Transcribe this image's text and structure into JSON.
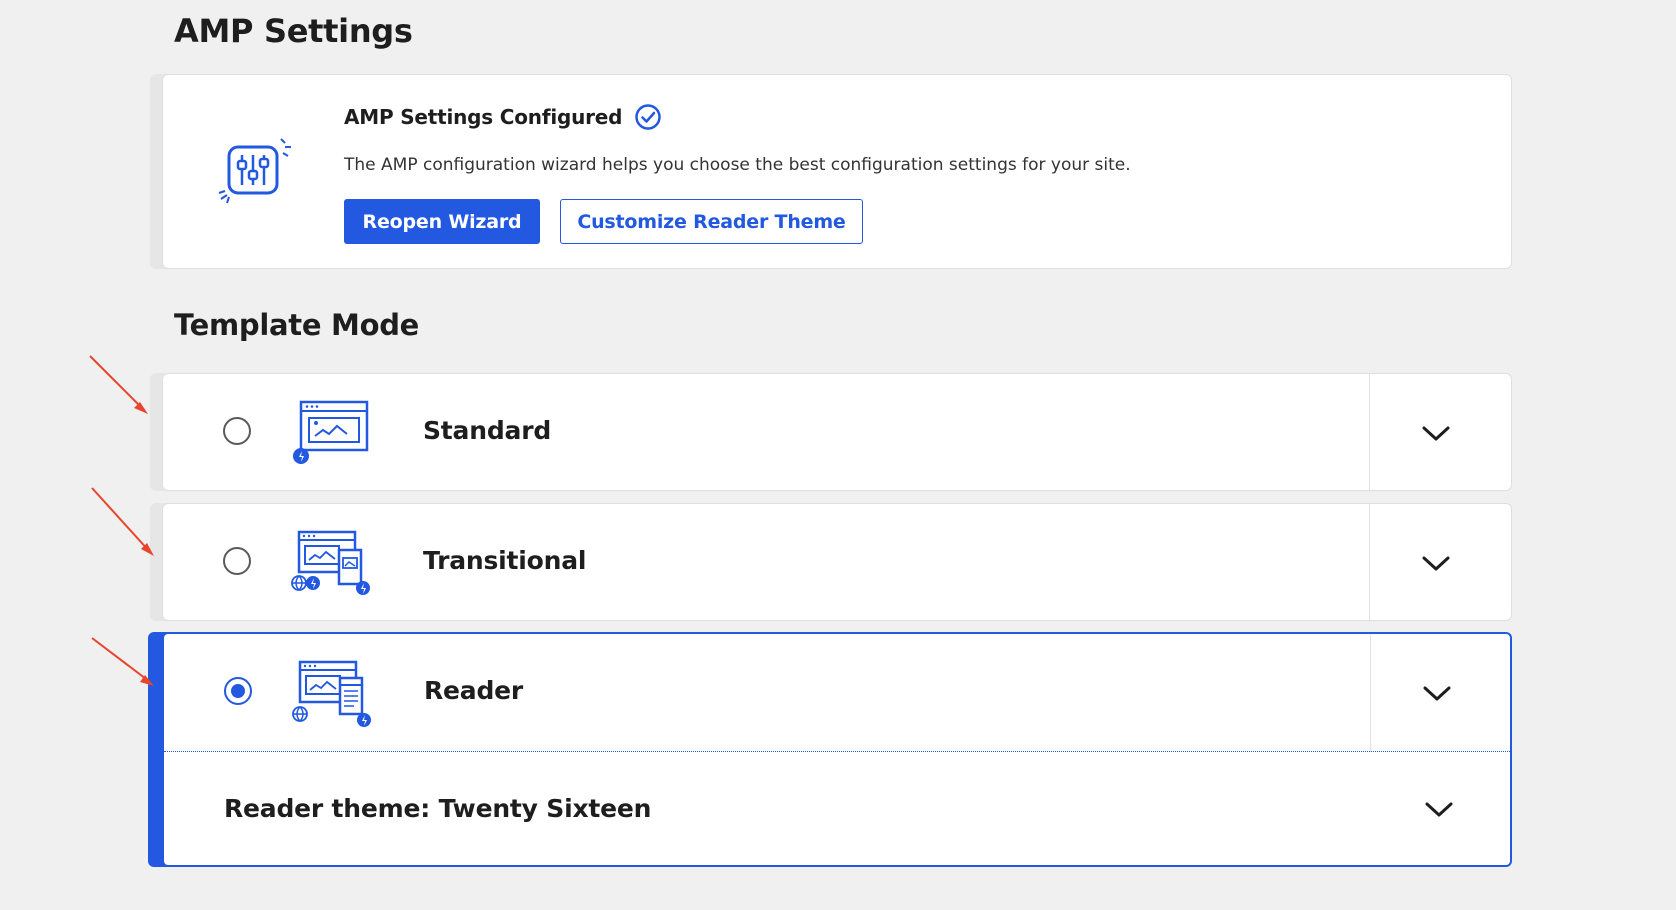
{
  "page_title": "AMP Settings",
  "config": {
    "heading": "AMP Settings Configured",
    "description": "The AMP configuration wizard helps you choose the best configuration settings for your site.",
    "reopen_label": "Reopen Wizard",
    "customize_label": "Customize Reader Theme"
  },
  "template_mode": {
    "title": "Template Mode",
    "options": [
      {
        "label": "Standard",
        "selected": false,
        "icon": "standard-mode-icon"
      },
      {
        "label": "Transitional",
        "selected": false,
        "icon": "transitional-mode-icon"
      },
      {
        "label": "Reader",
        "selected": true,
        "icon": "reader-mode-icon"
      }
    ],
    "reader_theme_label": "Reader theme: Twenty Sixteen"
  },
  "colors": {
    "accent": "#2259e0",
    "annotation_arrow": "#e8452c",
    "background": "#f0f0f0"
  },
  "icons": [
    "settings-sliders-icon",
    "check-circle-icon",
    "chevron-down-icon",
    "annotation-arrow"
  ]
}
